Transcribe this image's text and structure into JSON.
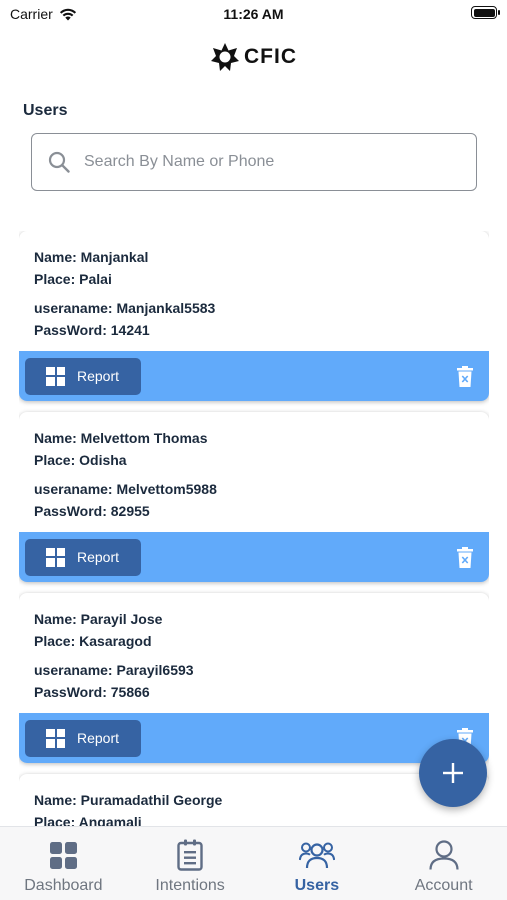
{
  "status_bar": {
    "carrier": "Carrier",
    "time": "11:26 AM"
  },
  "brand": {
    "logo_text": "CFIC"
  },
  "page": {
    "title": "Users"
  },
  "search": {
    "placeholder": "Search By Name or Phone"
  },
  "users": [
    {
      "name": "Name: Manjankal",
      "place": "Place: Palai",
      "username": "useraname: Manjankal5583",
      "password": "PassWord: 14241",
      "report_label": "Report"
    },
    {
      "name": "Name: Melvettom Thomas",
      "place": "Place: Odisha",
      "username": "useraname: Melvettom5988",
      "password": "PassWord: 82955",
      "report_label": "Report"
    },
    {
      "name": "Name: Parayil Jose",
      "place": "Place: Kasaragod",
      "username": "useraname: Parayil6593",
      "password": "PassWord: 75866",
      "report_label": "Report"
    },
    {
      "name": "Name: Puramadathil George",
      "place": "Place: Angamali",
      "username": "",
      "password": "",
      "report_label": ""
    }
  ],
  "fab": {
    "icon": "plus-icon"
  },
  "tabs": [
    {
      "label": "Dashboard",
      "icon": "dashboard-icon",
      "active": false
    },
    {
      "label": "Intentions",
      "icon": "clipboard-icon",
      "active": false
    },
    {
      "label": "Users",
      "icon": "users-icon",
      "active": true
    },
    {
      "label": "Account",
      "icon": "account-icon",
      "active": false
    }
  ],
  "colors": {
    "primary": "#3663a3",
    "card_footer": "#61aafa",
    "text": "#1b2a3d",
    "muted": "#6f7680"
  }
}
